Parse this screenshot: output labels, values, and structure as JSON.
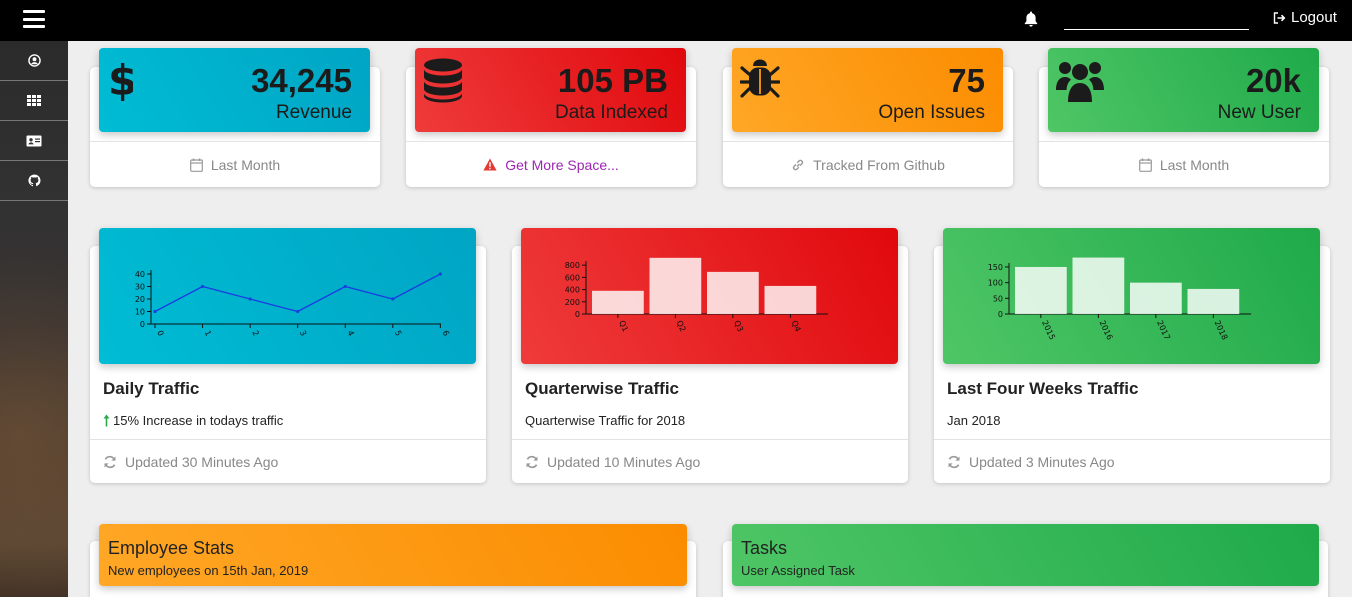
{
  "topbar": {
    "menu_icon": "hamburger-icon",
    "bell_icon": "bell-icon",
    "search_value": "",
    "logout_label": "Logout",
    "logout_icon": "sign-out-icon"
  },
  "sidebar": {
    "items": [
      {
        "icon": "user-circle-icon"
      },
      {
        "icon": "grid-icon"
      },
      {
        "icon": "id-card-icon"
      },
      {
        "icon": "github-icon"
      }
    ]
  },
  "stats": [
    {
      "icon": "dollar-icon",
      "value": "34,245",
      "label": "Revenue",
      "footer_icon": "calendar-icon",
      "footer": "Last Month",
      "color": "#00bcd4"
    },
    {
      "icon": "database-icon",
      "value": "105 PB",
      "label": "Data Indexed",
      "footer_icon": "warning-icon",
      "footer": "Get More Space...",
      "color": "#e53935"
    },
    {
      "icon": "bug-icon",
      "value": "75",
      "label": "Open Issues",
      "footer_icon": "link-icon",
      "footer": "Tracked From Github",
      "color": "#fb8c00"
    },
    {
      "icon": "users-icon",
      "value": "20k",
      "label": "New User",
      "footer_icon": "calendar-icon",
      "footer": "Last Month",
      "color": "#2db757"
    }
  ],
  "charts": [
    {
      "title": "Daily Traffic",
      "subtitle": "15% Increase in todays traffic",
      "subtitle_icon": "arrow-up-icon",
      "footer": "Updated 30 Minutes Ago",
      "footer_icon": "refresh-icon"
    },
    {
      "title": "Quarterwise Traffic",
      "subtitle": "Quarterwise Traffic for 2018",
      "footer": "Updated 10 Minutes Ago",
      "footer_icon": "refresh-icon"
    },
    {
      "title": "Last Four Weeks Traffic",
      "subtitle": "Jan 2018",
      "footer": "Updated 3 Minutes Ago",
      "footer_icon": "refresh-icon"
    }
  ],
  "chart_data": [
    {
      "type": "line",
      "x": [
        0,
        1,
        2,
        3,
        4,
        5,
        6
      ],
      "values": [
        10,
        30,
        20,
        10,
        30,
        20,
        40
      ],
      "ylim": [
        0,
        40
      ],
      "yticks": [
        0,
        10,
        20,
        30,
        40
      ],
      "line_color": "#1a3fe0"
    },
    {
      "type": "bar",
      "categories": [
        "Q1",
        "Q2",
        "Q3",
        "Q4"
      ],
      "values": [
        380,
        920,
        690,
        460
      ],
      "ylim": [
        0,
        950
      ],
      "yticks": [
        0,
        200,
        400,
        600,
        800
      ]
    },
    {
      "type": "bar",
      "categories": [
        "2015",
        "2016",
        "2017",
        "2018"
      ],
      "values": [
        150,
        180,
        100,
        80
      ],
      "ylim": [
        0,
        185
      ],
      "yticks": [
        0,
        50,
        100,
        150
      ]
    }
  ],
  "bottom": [
    {
      "title": "Employee Stats",
      "subtitle": "New employees on 15th Jan, 2019"
    },
    {
      "title": "Tasks",
      "subtitle": "User Assigned Task"
    }
  ]
}
